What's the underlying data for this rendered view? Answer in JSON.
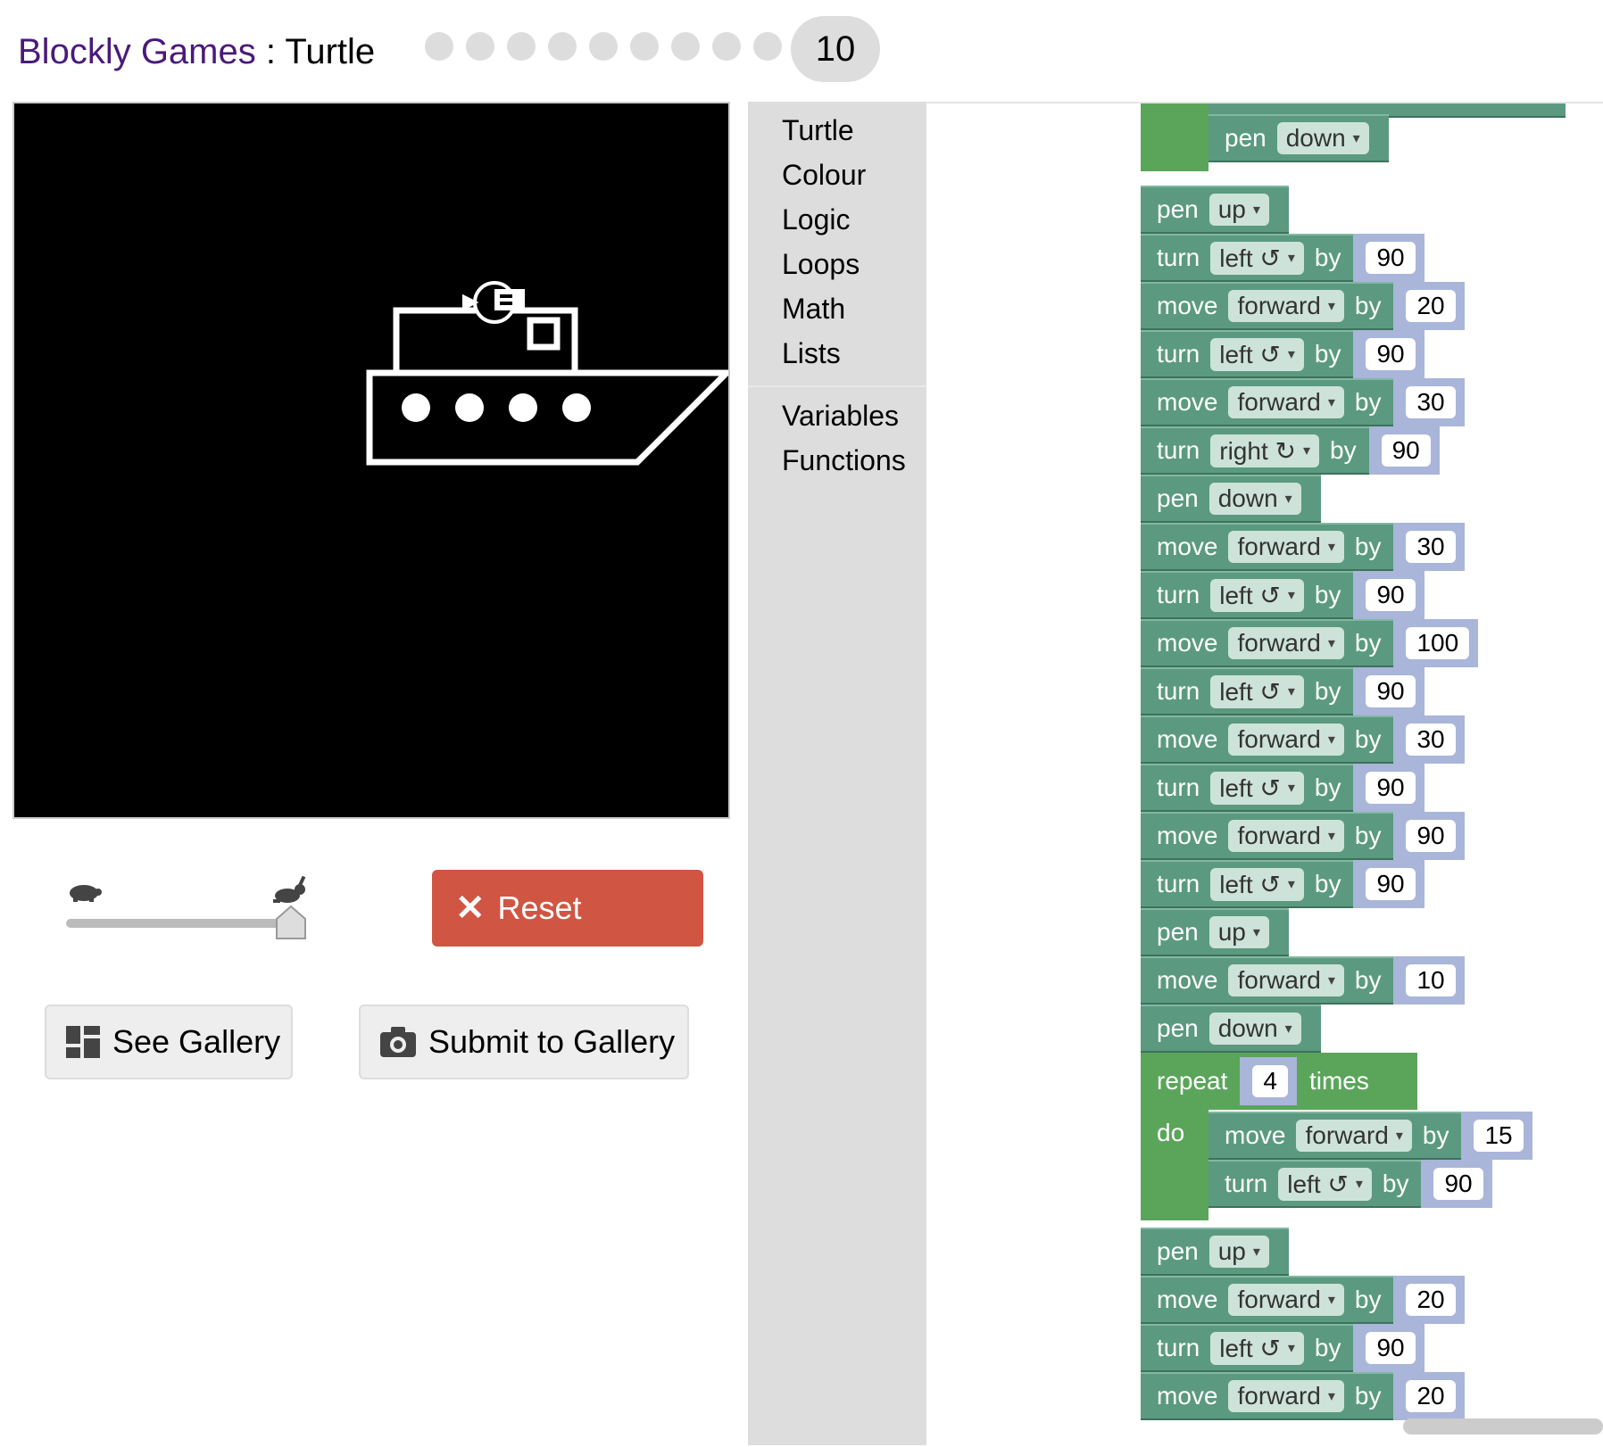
{
  "header": {
    "brand": "Blockly Games",
    "separator": " : ",
    "game": "Turtle",
    "level": "10",
    "dot_count": 9
  },
  "controls": {
    "reset_label": "Reset",
    "see_gallery_label": "See Gallery",
    "submit_gallery_label": "Submit to Gallery",
    "speed": 1.0
  },
  "toolbox": {
    "categories": [
      "Turtle",
      "Colour",
      "Logic",
      "Loops",
      "Math",
      "Lists"
    ],
    "extra": [
      "Variables",
      "Functions"
    ]
  },
  "blocks": {
    "pen": "pen",
    "move": "move",
    "turn": "turn",
    "by": "by",
    "repeat": "repeat",
    "times": "times",
    "do": "do",
    "stack": [
      {
        "t": "pen",
        "v": "down"
      },
      {
        "t": "pen",
        "v": "up"
      },
      {
        "t": "turn",
        "v": "left ↺",
        "n": "90"
      },
      {
        "t": "move",
        "v": "forward",
        "n": "20"
      },
      {
        "t": "turn",
        "v": "left ↺",
        "n": "90"
      },
      {
        "t": "move",
        "v": "forward",
        "n": "30"
      },
      {
        "t": "turn",
        "v": "right ↻",
        "n": "90"
      },
      {
        "t": "pen",
        "v": "down"
      },
      {
        "t": "move",
        "v": "forward",
        "n": "30"
      },
      {
        "t": "turn",
        "v": "left ↺",
        "n": "90"
      },
      {
        "t": "move",
        "v": "forward",
        "n": "100"
      },
      {
        "t": "turn",
        "v": "left ↺",
        "n": "90"
      },
      {
        "t": "move",
        "v": "forward",
        "n": "30"
      },
      {
        "t": "turn",
        "v": "left ↺",
        "n": "90"
      },
      {
        "t": "move",
        "v": "forward",
        "n": "90"
      },
      {
        "t": "turn",
        "v": "left ↺",
        "n": "90"
      },
      {
        "t": "pen",
        "v": "up"
      },
      {
        "t": "move",
        "v": "forward",
        "n": "10"
      },
      {
        "t": "pen",
        "v": "down"
      },
      {
        "t": "repeat",
        "n": "4"
      },
      {
        "t": "move",
        "v": "forward",
        "n": "15"
      },
      {
        "t": "turn",
        "v": "left ↺",
        "n": "90"
      },
      {
        "t": "pen",
        "v": "up"
      },
      {
        "t": "move",
        "v": "forward",
        "n": "20"
      },
      {
        "t": "turn",
        "v": "left ↺",
        "n": "90"
      },
      {
        "t": "move",
        "v": "forward",
        "n": "20"
      }
    ]
  },
  "colors": {
    "brand": "#4a1a7a",
    "reset": "#d05543",
    "loop_block": "#5ba55b",
    "turtle_block": "#5b9a80"
  }
}
